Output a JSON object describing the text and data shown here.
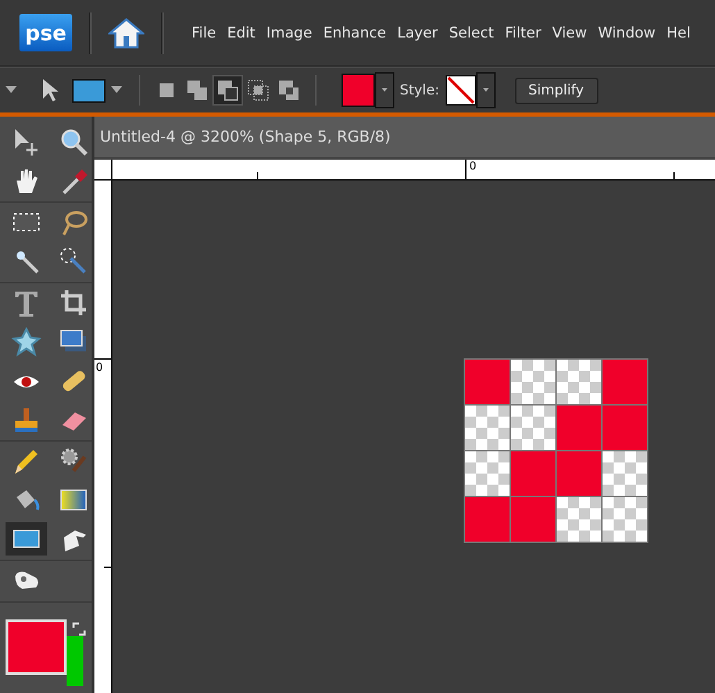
{
  "app": {
    "logo": "pse"
  },
  "menu": [
    "File",
    "Edit",
    "Image",
    "Enhance",
    "Layer",
    "Select",
    "Filter",
    "View",
    "Window",
    "Hel"
  ],
  "options_bar": {
    "shape_modes": [
      {
        "kind": "new",
        "selected": false
      },
      {
        "kind": "add",
        "selected": false
      },
      {
        "kind": "subtract",
        "selected": true
      },
      {
        "kind": "intersect",
        "selected": false
      },
      {
        "kind": "exclude",
        "selected": false
      }
    ],
    "swatches": [
      {
        "color": "#f0002a"
      }
    ],
    "style_label": "Style:",
    "simplify_button": "Simplify"
  },
  "tool_groups": [
    {
      "tools": [
        {
          "kind": "move",
          "selected": false
        },
        {
          "kind": "zoom",
          "selected": false
        },
        {
          "kind": "hand",
          "selected": false
        },
        {
          "kind": "eyedropper",
          "selected": false
        }
      ]
    },
    {
      "tools": [
        {
          "kind": "marquee",
          "selected": false
        },
        {
          "kind": "lasso",
          "selected": false
        },
        {
          "kind": "wand",
          "selected": false
        },
        {
          "kind": "quick-select",
          "selected": false
        }
      ]
    },
    {
      "tools": [
        {
          "kind": "type",
          "selected": false
        },
        {
          "kind": "crop",
          "selected": false
        },
        {
          "kind": "star",
          "selected": false
        },
        {
          "kind": "picture",
          "selected": false
        },
        {
          "kind": "eye",
          "selected": false
        },
        {
          "kind": "bandage",
          "selected": false
        },
        {
          "kind": "stamp",
          "selected": false
        },
        {
          "kind": "eraser",
          "selected": false
        }
      ]
    },
    {
      "tools": [
        {
          "kind": "pencil",
          "selected": false
        },
        {
          "kind": "gear-brush",
          "selected": false
        },
        {
          "kind": "bucket",
          "selected": false
        },
        {
          "kind": "gradient",
          "selected": false
        },
        {
          "kind": "shape",
          "selected": true
        },
        {
          "kind": "finger",
          "selected": false
        }
      ]
    },
    {
      "tools": [
        {
          "kind": "glove",
          "selected": false
        }
      ]
    }
  ],
  "colors": [
    {
      "kind": "foreground",
      "color": "#f0002a"
    },
    {
      "kind": "background",
      "color": "#00c800"
    }
  ],
  "document": {
    "title": "Untitled-4 @ 3200% (Shape 5, RGB/8)",
    "ruler_h_label": "0",
    "ruler_v_label": "0",
    "pixels": [
      [
        {
          "filled": true
        },
        {
          "filled": false
        },
        {
          "filled": false
        },
        {
          "filled": true
        }
      ],
      [
        {
          "filled": false
        },
        {
          "filled": false
        },
        {
          "filled": true
        },
        {
          "filled": true
        }
      ],
      [
        {
          "filled": false
        },
        {
          "filled": true
        },
        {
          "filled": true
        },
        {
          "filled": false
        }
      ],
      [
        {
          "filled": true
        },
        {
          "filled": true
        },
        {
          "filled": false
        },
        {
          "filled": false
        }
      ]
    ]
  }
}
